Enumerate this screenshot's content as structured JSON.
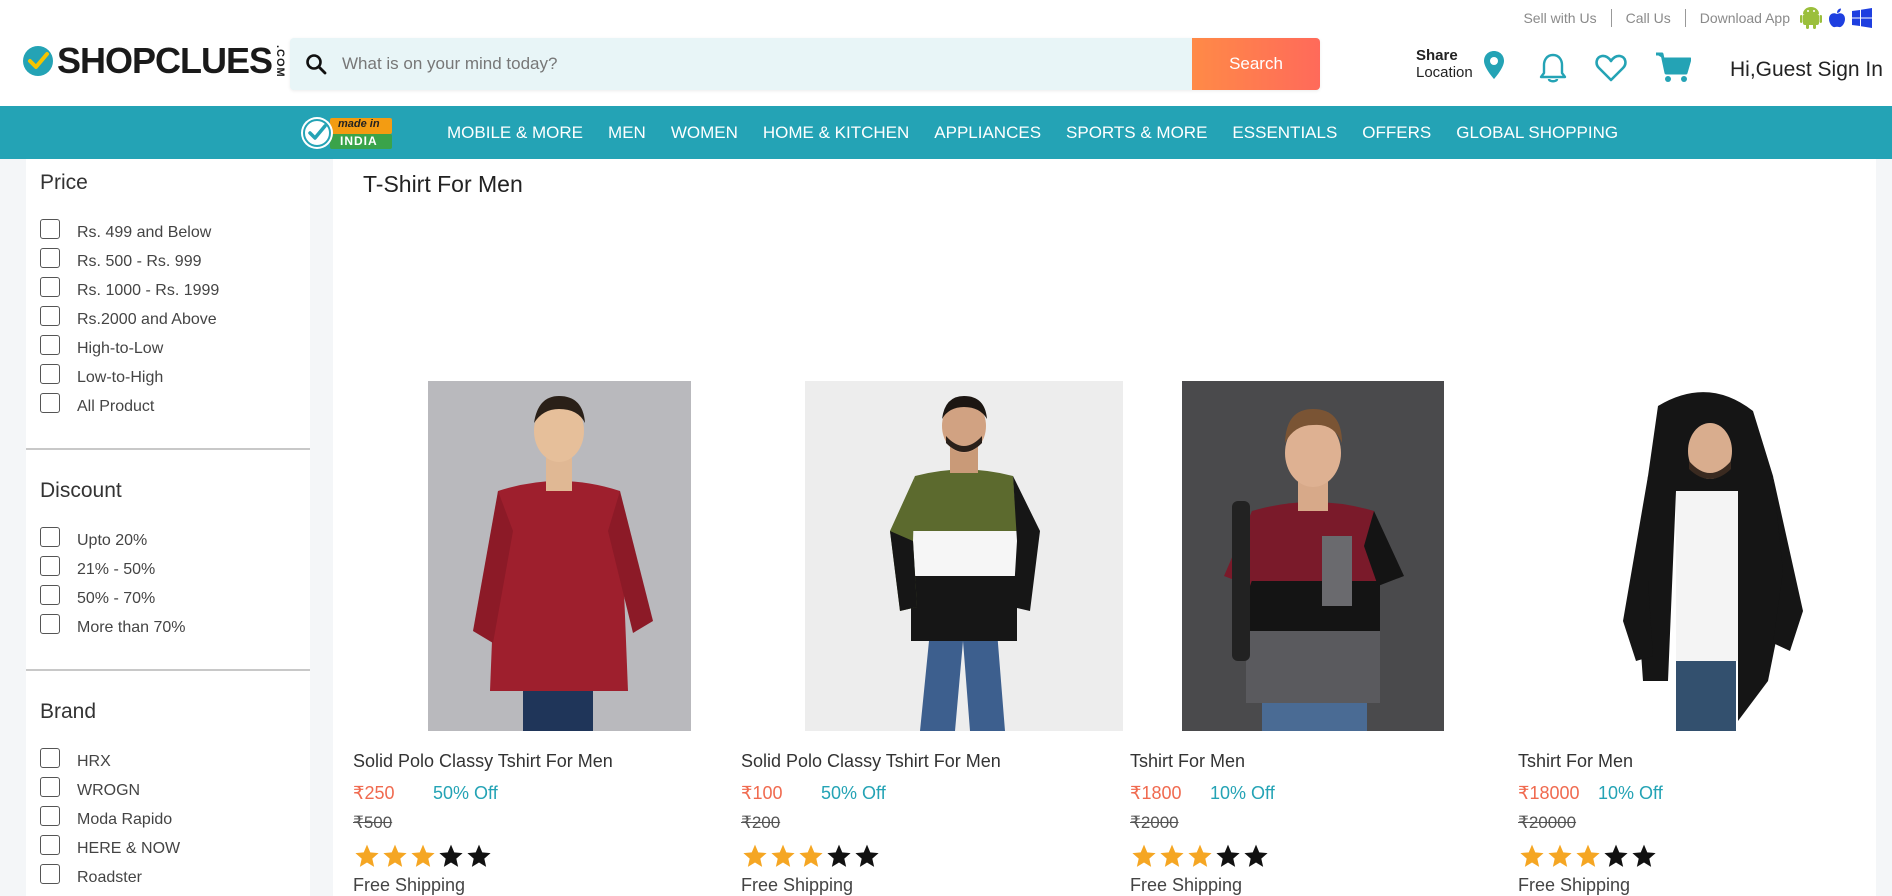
{
  "header": {
    "top_links": [
      "Sell with Us",
      "Call Us",
      "Download App"
    ],
    "logo_text": "SHOPCLUES",
    "logo_suffix": ".COM",
    "search_placeholder": "What is on your mind today?",
    "search_button": "Search",
    "share_line1": "Share",
    "share_line2": "Location",
    "signin": "Hi,Guest Sign In"
  },
  "nav": {
    "badge_top": "made in",
    "badge_bottom": "INDIA",
    "items": [
      "MOBILE & MORE",
      "MEN",
      "WOMEN",
      "HOME & KITCHEN",
      "APPLIANCES",
      "SPORTS & MORE",
      "ESSENTIALS",
      "OFFERS",
      "GLOBAL SHOPPING"
    ]
  },
  "filters": {
    "price": {
      "title": "Price",
      "options": [
        "Rs. 499 and Below",
        "Rs. 500 - Rs. 999",
        "Rs. 1000 - Rs. 1999",
        "Rs.2000 and Above",
        "High-to-Low",
        "Low-to-High",
        "All Product"
      ]
    },
    "discount": {
      "title": "Discount",
      "options": [
        "Upto 20%",
        "21% - 50%",
        "50% - 70%",
        "More than 70%"
      ]
    },
    "brand": {
      "title": "Brand",
      "options": [
        "HRX",
        "WROGN",
        "Moda Rapido",
        "HERE & NOW",
        "Roadster"
      ]
    }
  },
  "page_title": "T-Shirt For Men",
  "products": [
    {
      "name": "Solid Polo Classy Tshirt For Men",
      "price": "₹250",
      "discount": "50% Off",
      "mrp": "₹500",
      "rating": 3,
      "shipping": "Free Shipping"
    },
    {
      "name": "Solid Polo Classy Tshirt For Men",
      "price": "₹100",
      "discount": "50% Off",
      "mrp": "₹200",
      "rating": 3,
      "shipping": "Free Shipping"
    },
    {
      "name": "Tshirt For Men",
      "price": "₹1800",
      "discount": "10% Off",
      "mrp": "₹2000",
      "rating": 3,
      "shipping": "Free Shipping"
    },
    {
      "name": "Tshirt For Men",
      "price": "₹18000",
      "discount": "10% Off",
      "mrp": "₹20000",
      "rating": 3,
      "shipping": "Free Shipping"
    }
  ],
  "colors": {
    "accent": "#24a3b5",
    "price": "#f06a4f",
    "star_filled": "#f5a623",
    "star_empty": "#111111"
  }
}
